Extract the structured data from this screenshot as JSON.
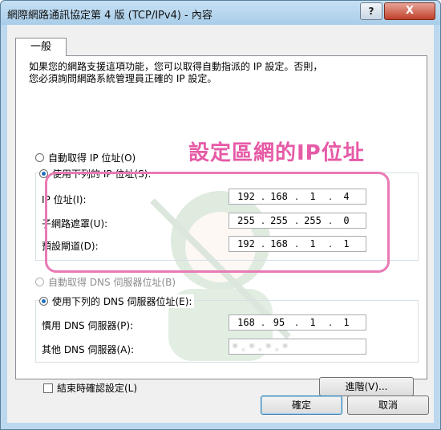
{
  "window": {
    "title": "網際網路通訊協定第 4 版 (TCP/IPv4) - 內容",
    "help_label": "?",
    "close_label": "X"
  },
  "tabs": [
    {
      "label": "一般"
    }
  ],
  "description": "如果您的網路支援這項功能，您可以取得自動指派的 IP 設定。否則，\n您必須詢問網路系統管理員正確的 IP 設定。",
  "annotation": "設定區網的IP位址",
  "ip_section": {
    "auto_label": "自動取得 IP 位址(O)",
    "manual_label": "使用下列的 IP 位址(S):",
    "selected": "manual",
    "fields": [
      {
        "label": "IP 位址(I):",
        "octets": [
          "192",
          "168",
          "1",
          "4"
        ]
      },
      {
        "label": "子網路遮罩(U):",
        "octets": [
          "255",
          "255",
          "255",
          "0"
        ]
      },
      {
        "label": "預設閘道(D):",
        "octets": [
          "192",
          "168",
          "1",
          "1"
        ]
      }
    ]
  },
  "dns_section": {
    "auto_label": "自動取得 DNS 伺服器位址(B)",
    "manual_label": "使用下列的 DNS 伺服器位址(E):",
    "selected": "manual",
    "fields": [
      {
        "label": "慣用 DNS 伺服器(P):",
        "octets": [
          "168",
          "95",
          "1",
          "1"
        ]
      },
      {
        "label": "其他 DNS 伺服器(A):",
        "obscured_value": "*.*.*.*"
      }
    ]
  },
  "validate_on_exit": {
    "label": "結束時確認設定(L)",
    "checked": false
  },
  "buttons": {
    "advanced": "進階(V)...",
    "ok": "確定",
    "cancel": "取消"
  },
  "colors": {
    "highlight": "#e97ab5",
    "annotation_text": "#e65aa6",
    "radio_dot": "#1f6fbf"
  }
}
